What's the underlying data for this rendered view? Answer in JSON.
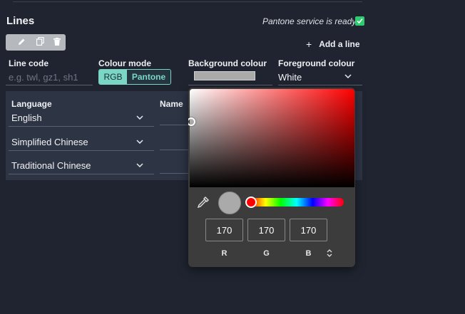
{
  "header": {
    "title": "Lines",
    "status": "Pantone service is ready",
    "add_line_label": "Add a line"
  },
  "toolbar": {
    "icons": [
      "pencil-icon",
      "copy-icon",
      "trash-icon"
    ]
  },
  "fields": {
    "line_code": {
      "label": "Line code",
      "placeholder": "e.g. twl, gz1, sh1",
      "value": ""
    },
    "colour_mode": {
      "label": "Colour mode",
      "options": [
        "RGB",
        "Pantone"
      ],
      "selected": "RGB"
    },
    "background_colour": {
      "label": "Background colour",
      "value": "#aaaaaa"
    },
    "foreground_colour": {
      "label": "Foreground colour",
      "value": "White"
    }
  },
  "names_panel": {
    "language_header": "Language",
    "name_header": "Name",
    "rows": [
      {
        "language": "English",
        "name": ""
      },
      {
        "language": "Simplified Chinese",
        "name": ""
      },
      {
        "language": "Traditional Chinese",
        "name": ""
      }
    ]
  },
  "color_picker": {
    "hue_color": "#ff0000",
    "preview_color": "#aaaaaa",
    "r": "170",
    "g": "170",
    "b": "170",
    "labels": {
      "r": "R",
      "g": "G",
      "b": "B"
    }
  },
  "colors": {
    "accent": "#7ad7c6",
    "success": "#2ecc71",
    "background": "#1f2430",
    "panel": "#2d3444"
  }
}
